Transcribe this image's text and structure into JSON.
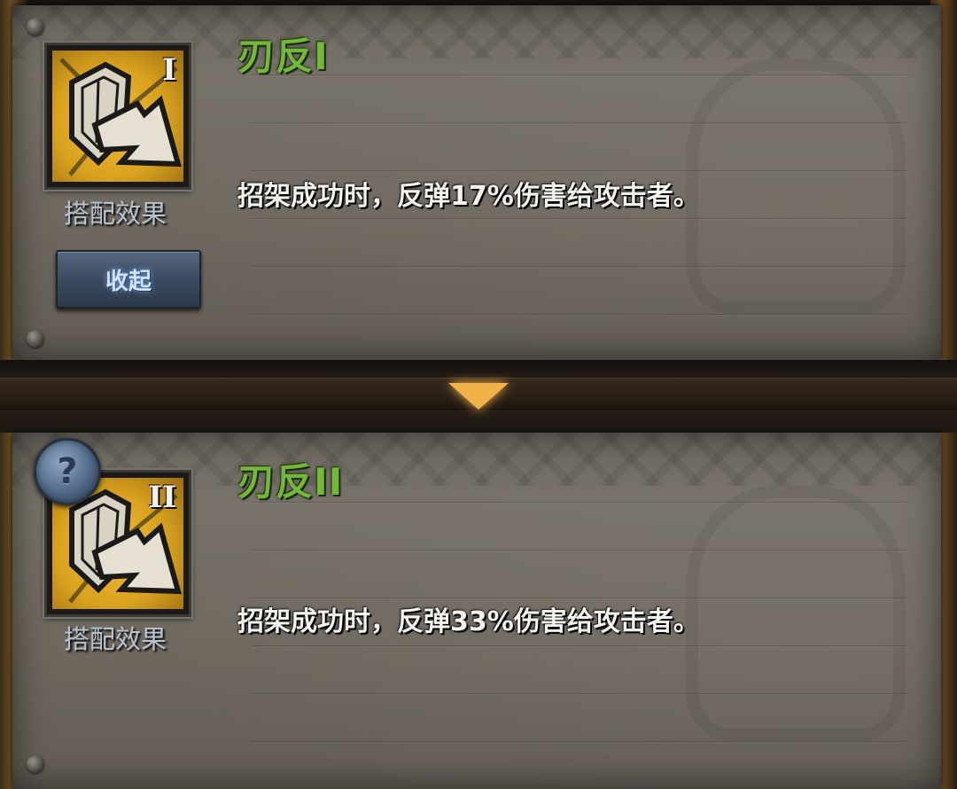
{
  "entries": [
    {
      "title": "刃反I",
      "tier": "I",
      "combo_label": "搭配效果",
      "description": "招架成功时，反弹17%伤害给攻击者。",
      "icon": "shield-rebound-icon"
    },
    {
      "title": "刃反II",
      "tier": "II",
      "combo_label": "搭配效果",
      "description": "招架成功时，反弹33%伤害给攻击者。",
      "icon": "shield-rebound-icon"
    }
  ],
  "collapse_button": {
    "label": "收起"
  },
  "help_button": {
    "label": "?",
    "icon": "help-icon"
  },
  "divider": {
    "icon": "chevron-down-icon",
    "color": "#f2b24a"
  },
  "colors": {
    "title_green": "#74b83a",
    "icon_gold": "#d8a11e",
    "button_blue": "#3e4d63"
  }
}
